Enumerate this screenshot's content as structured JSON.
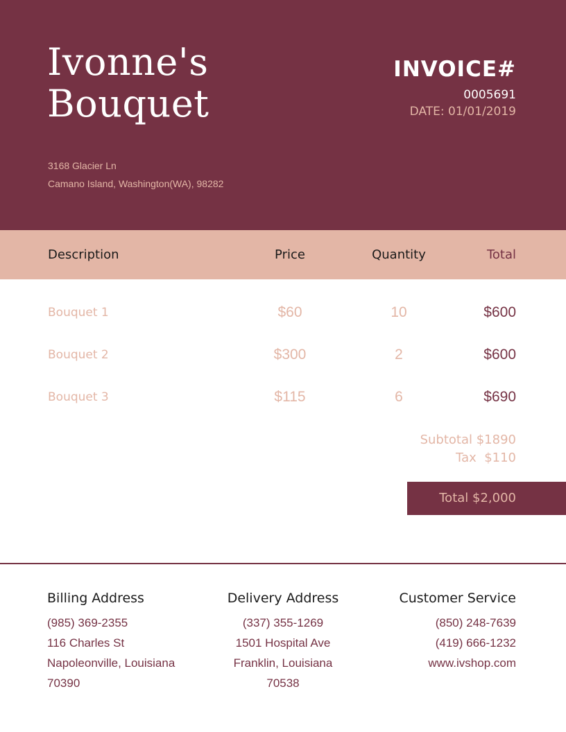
{
  "header": {
    "shop_name_line1": "Ivonne's",
    "shop_name_line2": "Bouquet",
    "address_line1": "3168 Glacier Ln",
    "address_line2": "Camano Island, Washington(WA), 98282",
    "invoice_title": "INVOICE#",
    "invoice_number": "0005691",
    "invoice_date": "DATE: 01/01/2019"
  },
  "table": {
    "columns": [
      "Description",
      "Price",
      "Quantity",
      "Total"
    ],
    "rows": [
      {
        "description": "Bouquet 1",
        "price": "$60",
        "quantity": "10",
        "total": "$600"
      },
      {
        "description": "Bouquet 2",
        "price": "$300",
        "quantity": "2",
        "total": "$600"
      },
      {
        "description": "Bouquet 3",
        "price": "$115",
        "quantity": "6",
        "total": "$690"
      }
    ]
  },
  "summary": {
    "subtotal": "Subtotal $1890",
    "tax": "Tax  $110",
    "total": "Total $2,000"
  },
  "footer": {
    "billing": {
      "title": "Billing Address",
      "lines": [
        "(985) 369-2355",
        "116 Charles St",
        "Napoleonville, Louisiana",
        "70390"
      ]
    },
    "delivery": {
      "title": "Delivery Address",
      "lines": [
        "(337) 355-1269",
        "1501 Hospital Ave",
        "Franklin, Louisiana",
        "70538"
      ]
    },
    "service": {
      "title": "Customer Service",
      "lines": [
        "(850) 248-7639",
        "(419) 666-1232",
        "www.ivshop.com"
      ]
    }
  },
  "colors": {
    "brand": "#753244",
    "accent": "#e3b6a6",
    "text_dark": "#1a1a1a",
    "background": "#ffffff"
  }
}
